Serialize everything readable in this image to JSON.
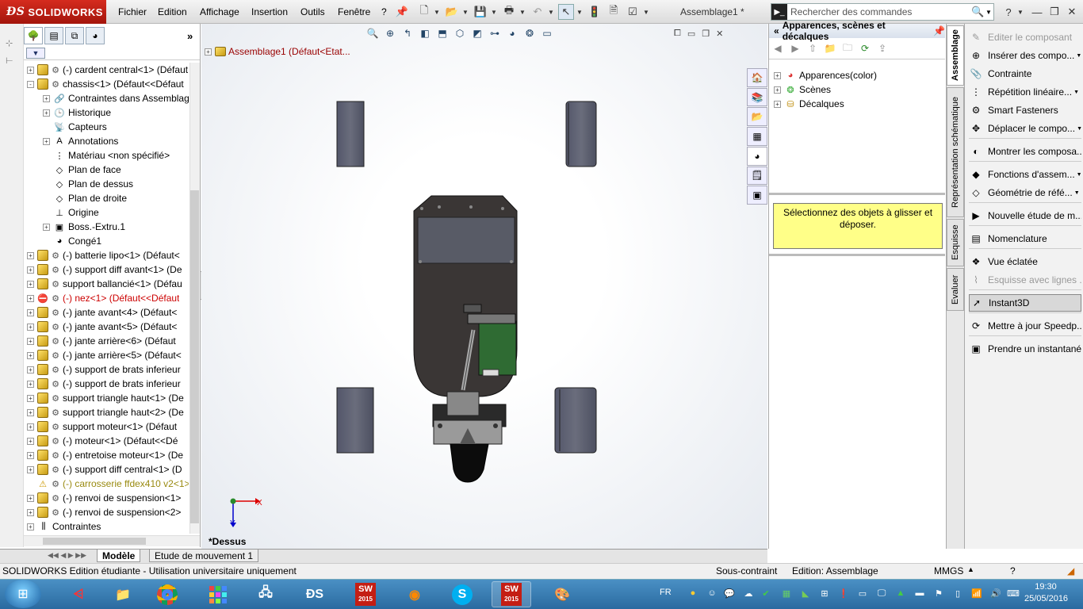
{
  "app": {
    "name": "SOLIDWORKS",
    "doc_title": "Assemblage1 *"
  },
  "menu": [
    "Fichier",
    "Edition",
    "Affichage",
    "Insertion",
    "Outils",
    "Fenêtre",
    "?"
  ],
  "search": {
    "placeholder": "Rechercher des commandes"
  },
  "tree": {
    "items": [
      {
        "label": "(-) cardent central<1> (Défaut",
        "indent": 0,
        "exp": "+",
        "icon": "part",
        "red": false
      },
      {
        "label": "chassis<1> (Défaut<<Défaut",
        "indent": 0,
        "exp": "-",
        "icon": "part",
        "red": false
      },
      {
        "label": "Contraintes dans Assemblag",
        "indent": 1,
        "exp": "+",
        "icon": "mate",
        "red": false
      },
      {
        "label": "Historique",
        "indent": 1,
        "exp": "+",
        "icon": "history",
        "red": false
      },
      {
        "label": "Capteurs",
        "indent": 1,
        "exp": "",
        "icon": "sensor",
        "red": false
      },
      {
        "label": "Annotations",
        "indent": 1,
        "exp": "+",
        "icon": "annot",
        "red": false
      },
      {
        "label": "Matériau <non spécifié>",
        "indent": 1,
        "exp": "",
        "icon": "material",
        "red": false
      },
      {
        "label": "Plan de face",
        "indent": 1,
        "exp": "",
        "icon": "plane",
        "red": false
      },
      {
        "label": "Plan de dessus",
        "indent": 1,
        "exp": "",
        "icon": "plane",
        "red": false
      },
      {
        "label": "Plan de droite",
        "indent": 1,
        "exp": "",
        "icon": "plane",
        "red": false
      },
      {
        "label": "Origine",
        "indent": 1,
        "exp": "",
        "icon": "origin",
        "red": false
      },
      {
        "label": "Boss.-Extru.1",
        "indent": 1,
        "exp": "+",
        "icon": "boss",
        "red": false
      },
      {
        "label": "Congé1",
        "indent": 1,
        "exp": "",
        "icon": "fillet",
        "red": false
      },
      {
        "label": "(-) batterie lipo<1> (Défaut<",
        "indent": 0,
        "exp": "+",
        "icon": "part",
        "red": false
      },
      {
        "label": "(-) support diff avant<1> (De",
        "indent": 0,
        "exp": "+",
        "icon": "part",
        "red": false
      },
      {
        "label": "support ballancié<1> (Défau",
        "indent": 0,
        "exp": "+",
        "icon": "part",
        "red": false
      },
      {
        "label": "(-) nez<1> (Défaut<<Défaut",
        "indent": 0,
        "exp": "+",
        "icon": "error",
        "red": true
      },
      {
        "label": "(-) jante avant<4> (Défaut<",
        "indent": 0,
        "exp": "+",
        "icon": "part",
        "red": false
      },
      {
        "label": "(-) jante avant<5> (Défaut<",
        "indent": 0,
        "exp": "+",
        "icon": "part",
        "red": false
      },
      {
        "label": "(-) jante arrière<6> (Défaut",
        "indent": 0,
        "exp": "+",
        "icon": "part",
        "red": false
      },
      {
        "label": "(-) jante arrière<5> (Défaut<",
        "indent": 0,
        "exp": "+",
        "icon": "part",
        "red": false
      },
      {
        "label": "(-) support de brats inferieur",
        "indent": 0,
        "exp": "+",
        "icon": "part",
        "red": false
      },
      {
        "label": "(-) support de brats inferieur",
        "indent": 0,
        "exp": "+",
        "icon": "part",
        "red": false
      },
      {
        "label": "support triangle haut<1> (De",
        "indent": 0,
        "exp": "+",
        "icon": "part",
        "red": false
      },
      {
        "label": "support triangle haut<2> (De",
        "indent": 0,
        "exp": "+",
        "icon": "part",
        "red": false
      },
      {
        "label": "support moteur<1> (Défaut",
        "indent": 0,
        "exp": "+",
        "icon": "part",
        "red": false
      },
      {
        "label": "(-) moteur<1> (Défaut<<Dé",
        "indent": 0,
        "exp": "+",
        "icon": "part",
        "red": false
      },
      {
        "label": "(-) entretoise moteur<1> (De",
        "indent": 0,
        "exp": "+",
        "icon": "part",
        "red": false
      },
      {
        "label": "(-) support diff central<1> (D",
        "indent": 0,
        "exp": "+",
        "icon": "part",
        "red": false
      },
      {
        "label": "(-) carrosserie ffdex410 v2<1>",
        "indent": 0,
        "exp": "",
        "icon": "warn",
        "red": false,
        "warn": true
      },
      {
        "label": "(-) renvoi de suspension<1>",
        "indent": 0,
        "exp": "+",
        "icon": "part",
        "red": false
      },
      {
        "label": "(-) renvoi de suspension<2>",
        "indent": 0,
        "exp": "+",
        "icon": "part",
        "red": false
      },
      {
        "label": "Contraintes",
        "indent": 0,
        "exp": "+",
        "icon": "mates",
        "red": false
      }
    ]
  },
  "graphics": {
    "root": "Assemblage1  (Défaut<Etat...",
    "view_label": "*Dessus",
    "triad_x": "X",
    "triad_y": "Y"
  },
  "appearance_pane": {
    "title": "Apparences, scènes et décalques",
    "items": [
      "Apparences(color)",
      "Scènes",
      "Décalques"
    ],
    "drop_hint": "Sélectionnez des objets à glisser et déposer."
  },
  "vtabs": [
    "Assemblage",
    "Représentation schématique",
    "Esquisse",
    "Evaluer"
  ],
  "commands": [
    {
      "label": "Editer le composant",
      "icon": "✎",
      "disabled": true
    },
    {
      "label": "Insérer des compo...",
      "icon": "⊕",
      "disabled": false,
      "arrow": true
    },
    {
      "label": "Contrainte",
      "icon": "📎",
      "disabled": false
    },
    {
      "label": "Répétition linéaire...",
      "icon": "⋮",
      "disabled": false,
      "arrow": true
    },
    {
      "label": "Smart Fasteners",
      "icon": "⚙",
      "disabled": false
    },
    {
      "label": "Déplacer le compo...",
      "icon": "✥",
      "disabled": false,
      "arrow": true
    },
    {
      "label": "Montrer les composa...",
      "icon": "◐",
      "disabled": false
    },
    {
      "label": "Fonctions d'assem...",
      "icon": "◆",
      "disabled": false,
      "arrow": true
    },
    {
      "label": "Géométrie de réfé...",
      "icon": "◇",
      "disabled": false,
      "arrow": true
    },
    {
      "label": "Nouvelle étude de m...",
      "icon": "▶",
      "disabled": false
    },
    {
      "label": "Nomenclature",
      "icon": "▤",
      "disabled": false
    },
    {
      "label": "Vue éclatée",
      "icon": "❖",
      "disabled": false
    },
    {
      "label": "Esquisse avec lignes ...",
      "icon": "⌇",
      "disabled": true
    },
    {
      "label": "Instant3D",
      "icon": "➚",
      "disabled": false,
      "active": true
    },
    {
      "label": "Mettre à jour Speedp...",
      "icon": "⟳",
      "disabled": false
    },
    {
      "label": "Prendre un instantané",
      "icon": "▣",
      "disabled": false
    }
  ],
  "bottom_tabs": [
    "Modèle",
    "Etude de mouvement 1"
  ],
  "status": {
    "left": "SOLIDWORKS Edition étudiante - Utilisation universitaire uniquement",
    "constraint": "Sous-contraint",
    "mode": "Edition: Assemblage",
    "units": "MMGS"
  },
  "taskbar": {
    "lang": "FR",
    "time": "19:30",
    "date": "25/05/2016",
    "sw_year": "2015"
  },
  "colors": {
    "brand_red": "#c41e14",
    "chassis": "#3a3635",
    "wheel": "#5c5f6e",
    "motor": "#2f6b33",
    "drop_box": "#ffff88"
  }
}
